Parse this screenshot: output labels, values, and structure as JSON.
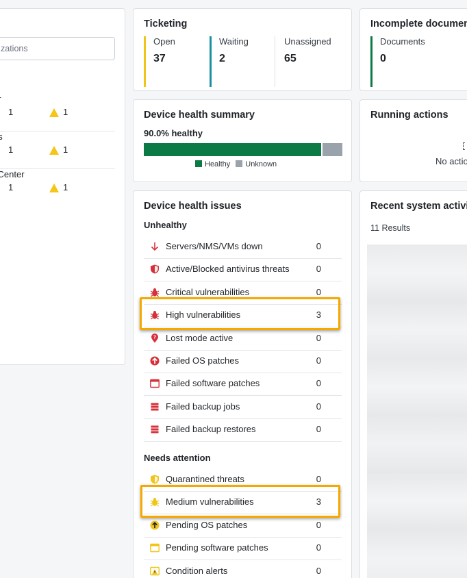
{
  "organizations": {
    "search_placeholder": "zations",
    "rows": [
      {
        "name": "er",
        "errors": "1",
        "warnings": "1"
      },
      {
        "name": "as",
        "errors": "1",
        "warnings": "1"
      },
      {
        "name": "l Center",
        "errors": "1",
        "warnings": "1"
      }
    ]
  },
  "ticketing": {
    "title": "Ticketing",
    "stats": [
      {
        "label": "Open",
        "value": "37",
        "color": "#f0c419"
      },
      {
        "label": "Waiting",
        "value": "2",
        "color": "#1b8fa0"
      },
      {
        "label": "Unassigned",
        "value": "65",
        "color": "#dcdfe3"
      }
    ]
  },
  "incomplete_docs": {
    "title": "Incomplete documen",
    "stat": {
      "label": "Documents",
      "value": "0",
      "color": "#0b7a45"
    }
  },
  "health_summary": {
    "title": "Device health summary",
    "percent_text": "90.0% healthy",
    "healthy_fraction": 0.9,
    "legend": {
      "healthy": "Healthy",
      "unknown": "Unknown"
    },
    "colors": {
      "healthy": "#0b7a45",
      "unknown": "#9aa3ab"
    }
  },
  "running_actions": {
    "title": "Running actions",
    "empty_text": "No actio"
  },
  "health_issues": {
    "title": "Device health issues",
    "unhealthy_label": "Unhealthy",
    "unhealthy": [
      {
        "icon": "arrow-down-icon",
        "label": "Servers/NMS/VMs down",
        "count": "0"
      },
      {
        "icon": "shield-icon",
        "label": "Active/Blocked antivirus threats",
        "count": "0"
      },
      {
        "icon": "bug-icon",
        "label": "Critical vulnerabilities",
        "count": "0"
      },
      {
        "icon": "bug-icon",
        "label": "High vulnerabilities",
        "count": "3"
      },
      {
        "icon": "map-pin-icon",
        "label": "Lost mode active",
        "count": "0"
      },
      {
        "icon": "arrow-up-circle-icon",
        "label": "Failed OS patches",
        "count": "0"
      },
      {
        "icon": "window-icon",
        "label": "Failed software patches",
        "count": "0"
      },
      {
        "icon": "server-icon",
        "label": "Failed backup jobs",
        "count": "0"
      },
      {
        "icon": "server-icon",
        "label": "Failed backup restores",
        "count": "0"
      }
    ],
    "attention_label": "Needs attention",
    "attention": [
      {
        "icon": "shield-icon",
        "label": "Quarantined threats",
        "count": "0"
      },
      {
        "icon": "bug-icon",
        "label": "Medium vulnerabilities",
        "count": "3"
      },
      {
        "icon": "arrow-up-circle-icon",
        "label": "Pending OS patches",
        "count": "0"
      },
      {
        "icon": "window-icon",
        "label": "Pending software patches",
        "count": "0"
      },
      {
        "icon": "warning-icon",
        "label": "Condition alerts",
        "count": "0"
      }
    ]
  },
  "recent_activity": {
    "title": "Recent system activi",
    "results": "11 Results"
  },
  "colors": {
    "red": "#d6303a",
    "yellow": "#f0c419",
    "highlight": "#f5a800"
  }
}
